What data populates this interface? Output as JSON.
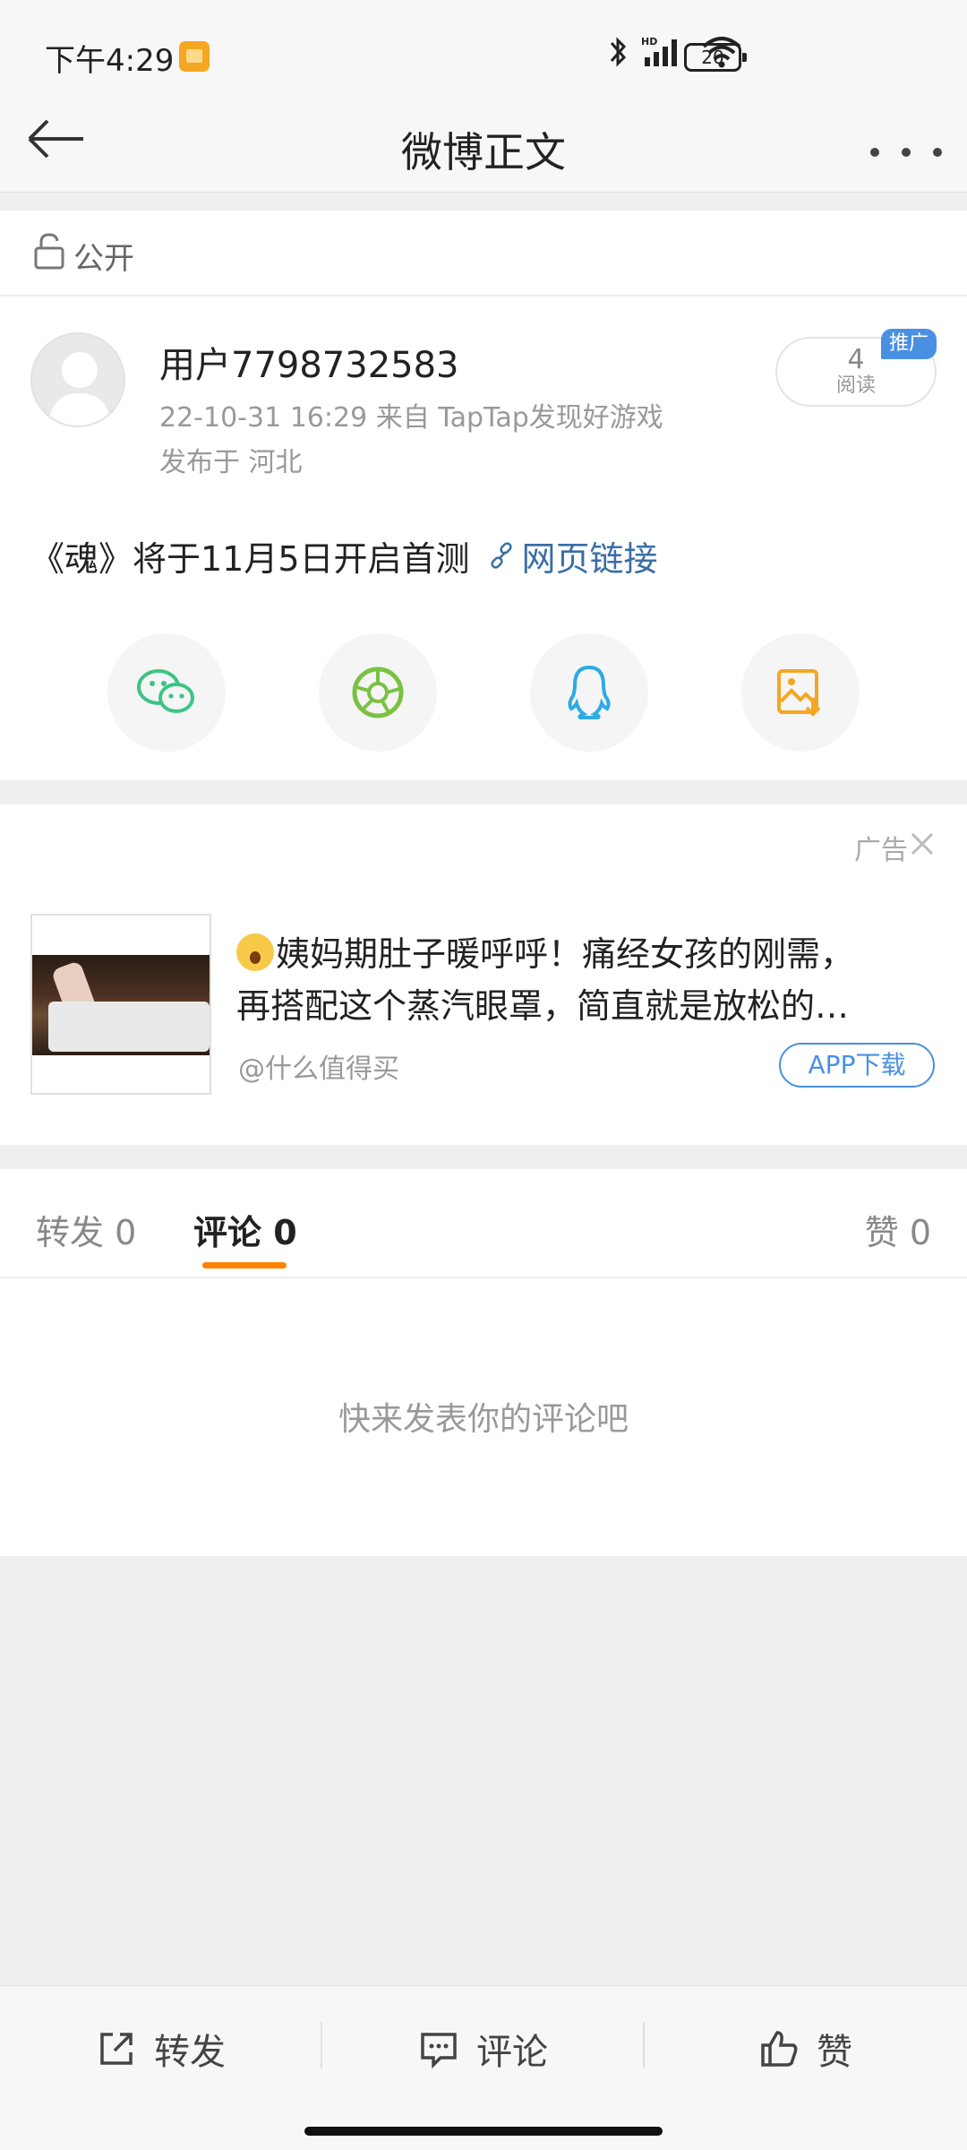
{
  "status_bar": {
    "time": "下午4:29",
    "battery": "20"
  },
  "nav": {
    "title": "微博正文",
    "back_icon": "back-arrow-icon",
    "more_icon": "more-dots-icon"
  },
  "visibility": {
    "label": "公开",
    "icon": "lock-icon"
  },
  "post": {
    "username": "用户7798732583",
    "meta": "22-10-31 16:29   来自 TapTap发现好游戏",
    "location": "发布于 河北",
    "read_count": "4",
    "read_label": "阅读",
    "promo_tag": "推广",
    "text": "《魂》将于11月5日开启首测",
    "link_text": "网页链接",
    "share_targets": [
      "wechat-icon",
      "moments-icon",
      "qq-icon",
      "save-image-icon"
    ]
  },
  "ad": {
    "label": "广告",
    "text_line1": "姨妈期肚子暖呼呼！痛经女孩的刚需，",
    "text_line2": "再搭配这个蒸汽眼罩，简直就是放松的…",
    "source": "@什么值得买",
    "download_button": "APP下载"
  },
  "tabs": {
    "repost": "转发 0",
    "comment": "评论 0",
    "like": "赞 0",
    "active": "comment"
  },
  "comments": {
    "empty_hint": "快来发表你的评论吧"
  },
  "bottom_bar": {
    "repost": "转发",
    "comment": "评论",
    "like": "赞"
  },
  "colors": {
    "accent_orange": "#ff8200",
    "link_blue": "#3a6ea5",
    "ad_blue": "#4a90e2"
  }
}
